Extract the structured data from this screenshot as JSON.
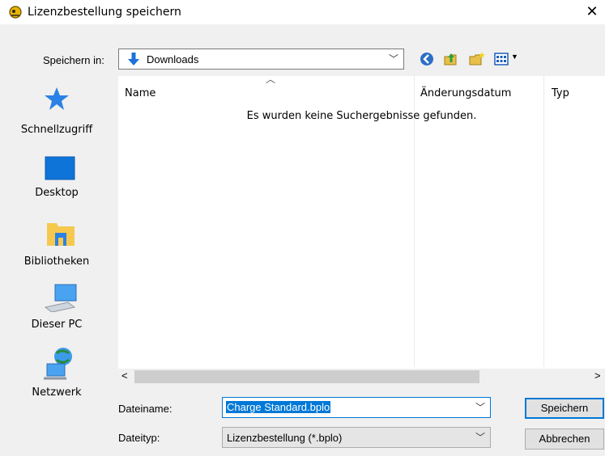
{
  "window": {
    "title": "Lizenzbestellung speichern",
    "close_glyph": "✕",
    "app_icon": "app-icon"
  },
  "location": {
    "label": "Speichern in:",
    "value": "Downloads",
    "icon": "download-arrow-icon"
  },
  "toolbar": {
    "icons": [
      "back-icon",
      "up-folder-icon",
      "new-folder-icon",
      "view-menu-icon"
    ]
  },
  "places": [
    {
      "label": "Schnellzugriff",
      "icon": "star-icon"
    },
    {
      "label": "Desktop",
      "icon": "desktop-icon"
    },
    {
      "label": "Bibliotheken",
      "icon": "library-icon"
    },
    {
      "label": "Dieser PC",
      "icon": "computer-icon"
    },
    {
      "label": "Netzwerk",
      "icon": "network-icon"
    }
  ],
  "list": {
    "columns": [
      "Name",
      "Änderungsdatum",
      "Typ"
    ],
    "empty_message": "Es wurden keine Suchergebnisse gefunden."
  },
  "filename": {
    "label": "Dateiname:",
    "value": "Charge Standard.bplo"
  },
  "filetype": {
    "label": "Dateityp:",
    "value": "Lizenzbestellung (*.bplo)"
  },
  "buttons": {
    "save": "Speichern",
    "cancel": "Abbrechen"
  },
  "colors": {
    "selection": "#0078d7",
    "accent_blue": "#2b82e4"
  }
}
